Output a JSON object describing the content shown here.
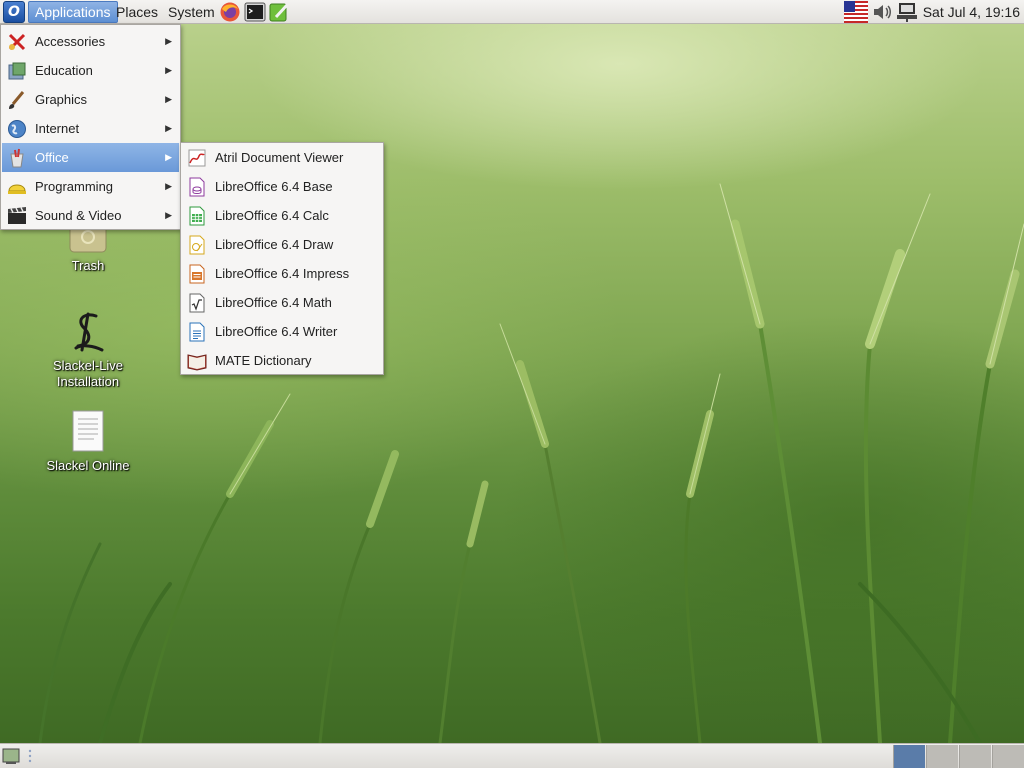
{
  "top_panel": {
    "logo_glyph": "O",
    "menus": {
      "applications": "Applications",
      "places": "Places",
      "system": "System"
    },
    "launchers": [
      "firefox-icon",
      "terminal-icon",
      "text-editor-icon"
    ],
    "tray": [
      "us-flag-icon",
      "volume-icon",
      "network-icon"
    ],
    "clock": "Sat Jul  4, 19:16"
  },
  "desktop_icons": {
    "trash": "Trash",
    "slackel_live_line1": "Slackel-Live",
    "slackel_live_line2": "Installation",
    "slackel_online": "Slackel Online"
  },
  "app_menu": {
    "items": [
      {
        "label": "Accessories",
        "icon": "accessories-icon"
      },
      {
        "label": "Education",
        "icon": "education-icon"
      },
      {
        "label": "Graphics",
        "icon": "graphics-icon"
      },
      {
        "label": "Internet",
        "icon": "internet-icon"
      },
      {
        "label": "Office",
        "icon": "office-icon",
        "active": true
      },
      {
        "label": "Programming",
        "icon": "programming-icon"
      },
      {
        "label": "Sound & Video",
        "icon": "sound-video-icon"
      }
    ],
    "submenu_arrow": "▶"
  },
  "office_submenu": {
    "items": [
      {
        "label": "Atril Document Viewer",
        "icon": "document-viewer-icon"
      },
      {
        "label": "LibreOffice 6.4 Base",
        "icon": "libreoffice-base-icon"
      },
      {
        "label": "LibreOffice 6.4 Calc",
        "icon": "libreoffice-calc-icon"
      },
      {
        "label": "LibreOffice 6.4 Draw",
        "icon": "libreoffice-draw-icon"
      },
      {
        "label": "LibreOffice 6.4 Impress",
        "icon": "libreoffice-impress-icon"
      },
      {
        "label": "LibreOffice 6.4 Math",
        "icon": "libreoffice-math-icon"
      },
      {
        "label": "LibreOffice 6.4 Writer",
        "icon": "libreoffice-writer-icon"
      },
      {
        "label": "MATE Dictionary",
        "icon": "dictionary-icon"
      }
    ]
  },
  "bottom_panel": {
    "workspaces": 4,
    "active_workspace": 1
  },
  "colors": {
    "menu_highlight": "#7aa4dc",
    "panel": "#e8e6e3",
    "active_workspace": "#5a7ca9"
  }
}
